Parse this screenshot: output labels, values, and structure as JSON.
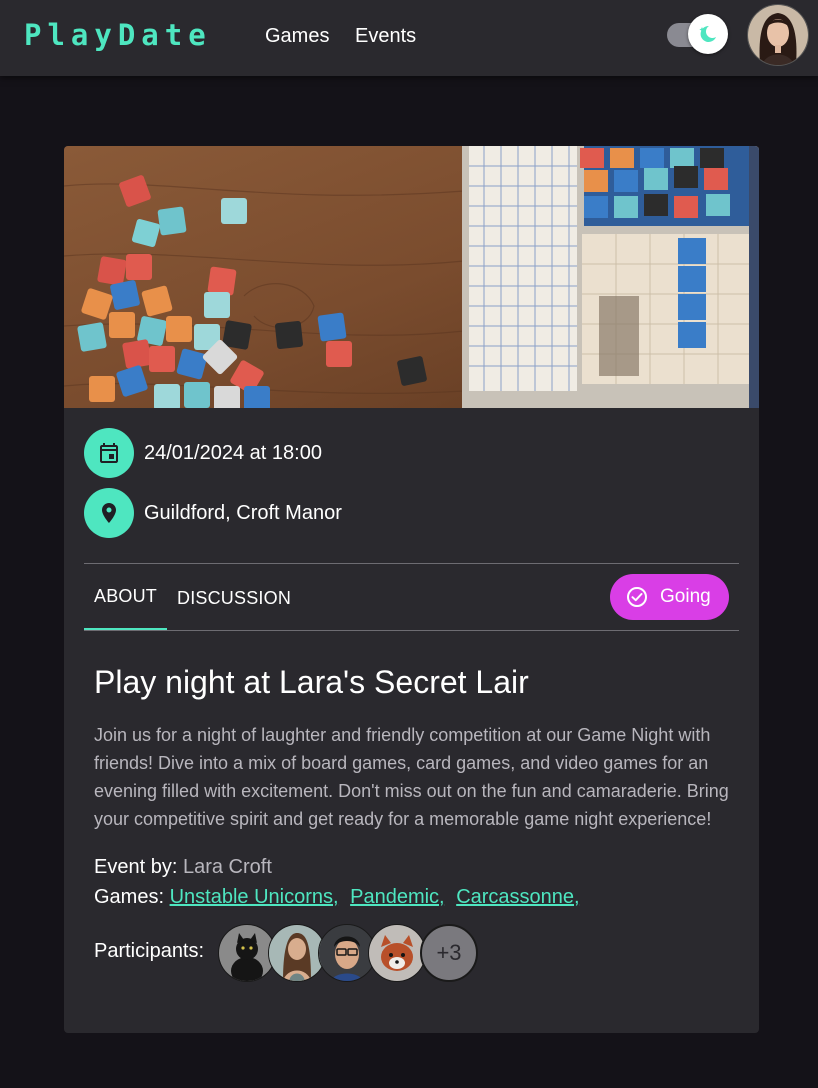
{
  "app": {
    "brand": "PlayDate",
    "nav": [
      {
        "label": "Games"
      },
      {
        "label": "Events"
      }
    ]
  },
  "event": {
    "datetime": "24/01/2024 at 18:00",
    "location": "Guildford, Croft Manor",
    "tabs": [
      {
        "label": "ABOUT",
        "active": true
      },
      {
        "label": "DISCUSSION",
        "active": false
      }
    ],
    "going_label": "Going",
    "title": "Play night at Lara's Secret Lair",
    "description_lines": [
      "Join us for a night of laughter and friendly competition at our Game Night with",
      "friends! Dive into a mix of board games, card games, and video games for an",
      "evening filled with excitement. Don't miss out on the fun and camaraderie. Bring",
      "your competitive spirit and get ready for a memorable game night experience!"
    ],
    "event_by_label": "Event by:",
    "event_by_value": "Lara Croft",
    "games_label": "Games:",
    "games": [
      "Unstable Unicorns,",
      "Pandemic,",
      "Carcassonne,"
    ],
    "participants_label": "Participants:",
    "participants_more": "+3"
  },
  "colors": {
    "accent": "#4ee6c0",
    "going": "#d93ee6",
    "background": "#141218",
    "surface": "#2a292e"
  },
  "icons": {
    "date": "calendar-icon",
    "location": "location-pin-icon",
    "going": "check-circle-icon",
    "theme": "moon-icon"
  }
}
